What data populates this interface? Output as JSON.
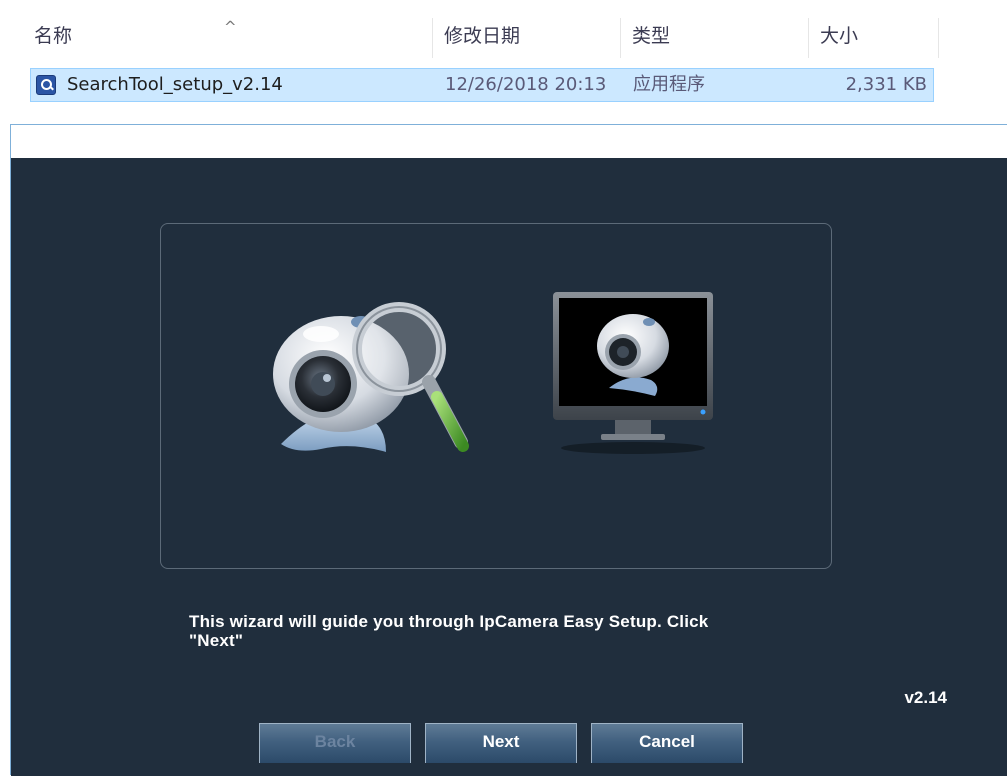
{
  "explorer": {
    "columns": {
      "name": "名称",
      "modified": "修改日期",
      "type": "类型",
      "size": "大小"
    },
    "sort_indicator": "^",
    "file": {
      "icon": "search-tool-app-icon",
      "name": "SearchTool_setup_v2.14",
      "modified": "12/26/2018 20:13",
      "type": "应用程序",
      "size": "2,331 KB"
    }
  },
  "installer": {
    "illustration": [
      "webcam-magnifier-icon",
      "monitor-webcam-icon"
    ],
    "message_line1": "This wizard will guide you through IpCamera Easy Setup. Click",
    "message_line2": "\"Next\"",
    "version": "v2.14",
    "buttons": {
      "back": "Back",
      "next": "Next",
      "cancel": "Cancel"
    },
    "colors": {
      "background": "#202e3d",
      "button": "#41607f",
      "selection": "#cce8ff"
    }
  }
}
